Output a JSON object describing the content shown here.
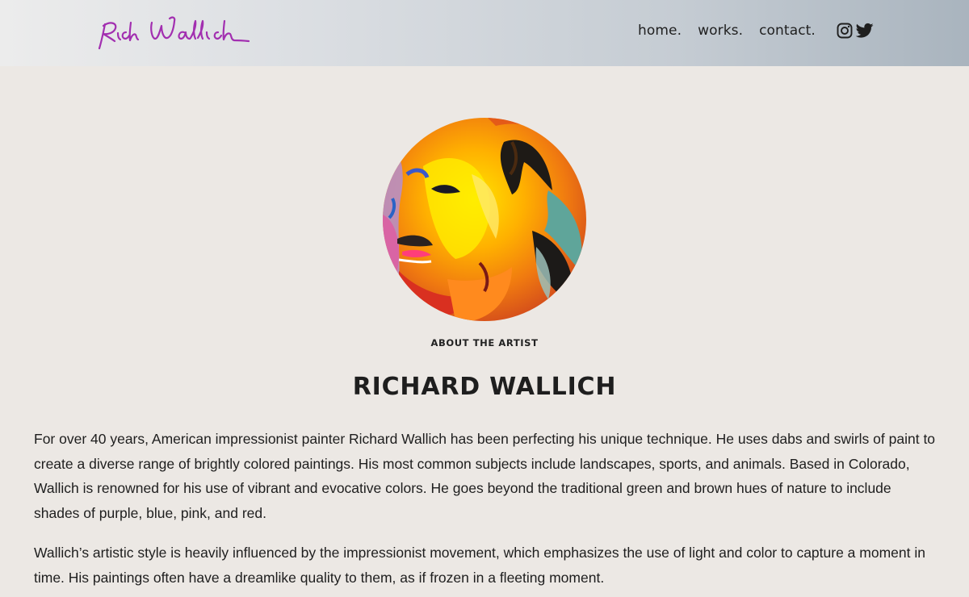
{
  "header": {
    "logo_text": "Rich Wallich",
    "nav": {
      "home": "home.",
      "works": "works.",
      "contact": "contact."
    },
    "social": {
      "instagram_icon": "instagram-icon",
      "twitter_icon": "twitter-icon"
    },
    "colors": {
      "logo": "#a22fb0",
      "gradient_start": "#ececec",
      "gradient_end": "#a9b4be"
    }
  },
  "main": {
    "portrait_icon": "artist-portrait-painting",
    "kicker": "ABOUT THE ARTIST",
    "title": "RICHARD WALLICH",
    "paragraphs": [
      "For over 40 years, American impressionist painter Richard Wallich has been perfecting his unique technique. He uses dabs and swirls of paint to create a diverse range of brightly colored paintings. His most common subjects include landscapes, sports, and animals. Based in Colorado, Wallich is renowned for his use of vibrant and evocative colors. He goes beyond the traditional green and brown hues of nature to include shades of purple, blue, pink, and red.",
      "Wallich’s artistic style is heavily influenced by the impressionist movement, which emphasizes the use of light and color to capture a moment in time. His paintings often have a dreamlike quality to them, as if frozen in a fleeting moment."
    ],
    "background": "#ece8e4"
  }
}
